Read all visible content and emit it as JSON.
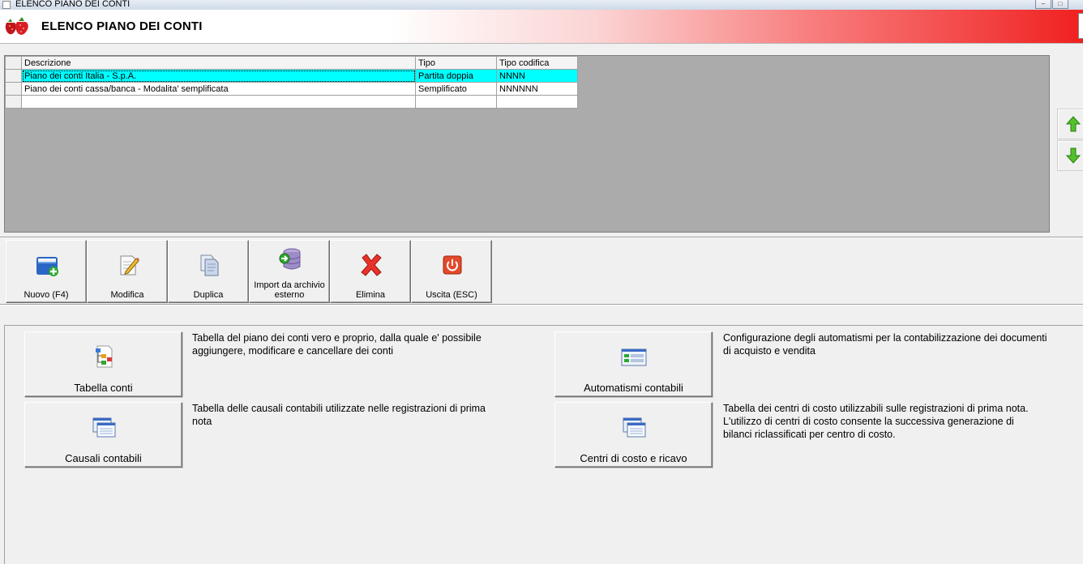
{
  "window": {
    "title": "ELENCO PIANO DEI CONTI"
  },
  "header": {
    "title": "ELENCO PIANO DEI CONTI"
  },
  "grid": {
    "columns": [
      "Descrizione",
      "Tipo",
      "Tipo codifica"
    ],
    "rows": [
      {
        "descrizione": "Piano dei conti Italia - S.p.A.",
        "tipo": "Partita doppia",
        "codifica": "NNNN",
        "selected": true
      },
      {
        "descrizione": "Piano dei conti cassa/banca - Modalita' semplificata",
        "tipo": "Semplificato",
        "codifica": "NNNNNN",
        "selected": false
      }
    ]
  },
  "toolbar": {
    "nuovo": "Nuovo (F4)",
    "modifica": "Modifica",
    "duplica": "Duplica",
    "import": "Import da archivio esterno",
    "elimina": "Elimina",
    "uscita": "Uscita (ESC)"
  },
  "functions": {
    "tabella_conti": {
      "label": "Tabella conti",
      "description": "Tabella del piano dei conti vero e proprio, dalla quale e' possibile aggiungere, modificare e cancellare dei conti"
    },
    "causali_contabili": {
      "label": "Causali contabili",
      "description": "Tabella delle causali contabili utilizzate nelle registrazioni di prima nota"
    },
    "automatismi_contabili": {
      "label": "Automatismi contabili",
      "description": "Configurazione degli automatismi per la contabilizzazione dei documenti di acquisto e vendita"
    },
    "centri_di_costo": {
      "label": "Centri di costo e ricavo",
      "description": "Tabella dei centri di costo utilizzabili sulle registrazioni di prima nota. L'utilizzo di centri di costo consente la successiva generazione di bilanci riclassificati per centro di costo."
    }
  },
  "colors": {
    "selected_row": "#00ffff",
    "header_accent": "#f02020",
    "grid_background": "#ababab"
  }
}
